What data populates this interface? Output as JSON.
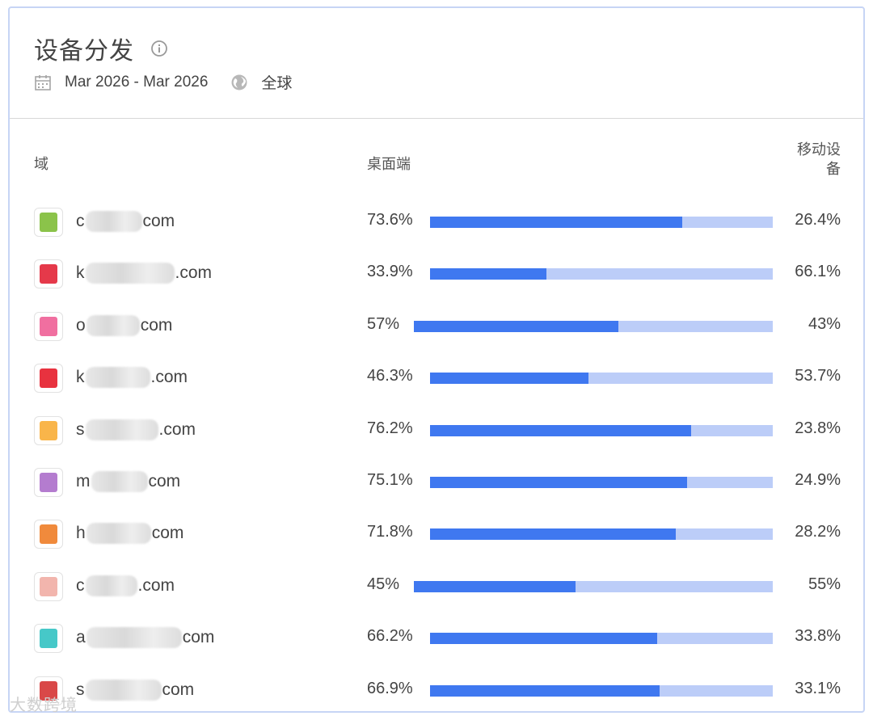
{
  "header": {
    "title": "设备分发",
    "date_range": "Mar 2026 - Mar 2026",
    "region": "全球"
  },
  "columns": {
    "domain": "域",
    "desktop": "桌面端",
    "mobile": "移动设备"
  },
  "rows": [
    {
      "prefix": "c",
      "suffix": "com",
      "desktop": "73.6%",
      "mobile": "26.4%",
      "desktop_share": 0.736,
      "color": "#8bc34a"
    },
    {
      "prefix": "k",
      "suffix": ".com",
      "desktop": "33.9%",
      "mobile": "66.1%",
      "desktop_share": 0.339,
      "color": "#e5394a"
    },
    {
      "prefix": "o",
      "suffix": "com",
      "desktop": "57%",
      "mobile": "43%",
      "desktop_share": 0.57,
      "color": "#f06fa0"
    },
    {
      "prefix": "k",
      "suffix": ".com",
      "desktop": "46.3%",
      "mobile": "53.7%",
      "desktop_share": 0.463,
      "color": "#e8323f"
    },
    {
      "prefix": "s",
      "suffix": ".com",
      "desktop": "76.2%",
      "mobile": "23.8%",
      "desktop_share": 0.762,
      "color": "#f9b54a"
    },
    {
      "prefix": "m",
      "suffix": "com",
      "desktop": "75.1%",
      "mobile": "24.9%",
      "desktop_share": 0.751,
      "color": "#b47ccf"
    },
    {
      "prefix": "h",
      "suffix": "com",
      "desktop": "71.8%",
      "mobile": "28.2%",
      "desktop_share": 0.718,
      "color": "#f08a3c"
    },
    {
      "prefix": "c",
      "suffix": ".com",
      "desktop": "45%",
      "mobile": "55%",
      "desktop_share": 0.45,
      "color": "#f2b5ad"
    },
    {
      "prefix": "a",
      "suffix": "com",
      "desktop": "66.2%",
      "mobile": "33.8%",
      "desktop_share": 0.662,
      "color": "#46c8c8"
    },
    {
      "prefix": "s",
      "suffix": "com",
      "desktop": "66.9%",
      "mobile": "33.1%",
      "desktop_share": 0.669,
      "color": "#d94848"
    }
  ],
  "watermark": "大数跨境",
  "colors": {
    "bar_desktop": "#3f78f0",
    "bar_mobile": "#bccdf8"
  }
}
